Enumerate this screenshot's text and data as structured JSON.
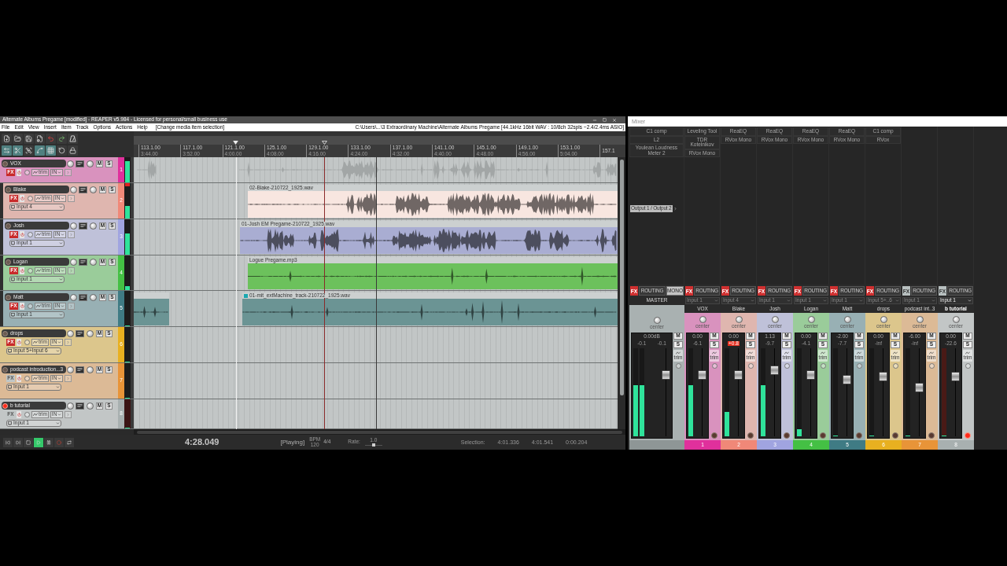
{
  "reaper": {
    "title": "Alternate Albums Pregame [modified] - REAPER v5.984 - Licensed for personal/small business use",
    "menu": [
      "File",
      "Edit",
      "View",
      "Insert",
      "Item",
      "Track",
      "Options",
      "Actions",
      "Help"
    ],
    "last_action": "[Change media item selection]",
    "project_info": "C:\\Users\\...\\3 Extraordinary Machine\\Alternate Albums Pregame [44.1kHz 16bit WAV : 10/8ch 32spls ~2.4/2.4ms ASIO]",
    "toolbar": [
      {
        "kind": "new",
        "on": false
      },
      {
        "kind": "open",
        "on": false
      },
      {
        "kind": "save",
        "on": false
      },
      {
        "kind": "settings",
        "on": false
      },
      {
        "kind": "undo",
        "on": false
      },
      {
        "kind": "redo",
        "on": false
      },
      {
        "kind": "metronome",
        "on": false
      },
      {
        "kind": "crossfade",
        "on": true
      },
      {
        "kind": "split",
        "on": true
      },
      {
        "kind": "group",
        "on": false
      },
      {
        "kind": "envelope",
        "on": true
      },
      {
        "kind": "grid",
        "on": true
      },
      {
        "kind": "ripple",
        "on": false
      },
      {
        "kind": "lock",
        "on": false
      }
    ],
    "ruler": [
      {
        "bar": "113.1.00",
        "time": "3:44.00"
      },
      {
        "bar": "117.1.00",
        "time": "3:52.00"
      },
      {
        "bar": "121.1.00",
        "time": "4:00.00"
      },
      {
        "bar": "125.1.00",
        "time": "4:08.00"
      },
      {
        "bar": "129.1.00",
        "time": "4:16.00"
      },
      {
        "bar": "133.1.00",
        "time": "4:24.00"
      },
      {
        "bar": "137.1.00",
        "time": "4:32.00"
      },
      {
        "bar": "141.1.00",
        "time": "4:40.00"
      },
      {
        "bar": "145.1.00",
        "time": "4:48.00"
      },
      {
        "bar": "149.1.00",
        "time": "4:56.00"
      },
      {
        "bar": "153.1.00",
        "time": "5:04.00"
      },
      {
        "bar": "157.1"
      }
    ],
    "tracks": [
      {
        "number": "1",
        "name": "VOX",
        "color": "#e0309c",
        "armed": false,
        "fx_active": true,
        "level": 0.85,
        "clip": false,
        "controls": {
          "fx": "FX",
          "trim": "trim",
          "monitor": "IN",
          "mute": "M",
          "solo": "S"
        },
        "items": [
          {
            "kind": "summary"
          },
          {
            "kind": "summary"
          }
        ],
        "children": [
          {
            "number": "2",
            "name": "Blake",
            "color": "#f08878",
            "armed": false,
            "fx_active": true,
            "level": 0.35,
            "clip": true,
            "input": "Input 4",
            "controls": {
              "fx": "FX",
              "trim": "trim",
              "monitor": "IN",
              "mute": "M",
              "solo": "S"
            },
            "items": [
              {
                "kind": "audio",
                "label": "02-Blake-210722_1925.wav",
                "color": "#f8e6e0",
                "indicator": false
              }
            ]
          },
          {
            "number": "3",
            "name": "Josh",
            "color": "#a0a4e0",
            "armed": false,
            "fx_active": true,
            "level": 0.6,
            "clip": false,
            "input": "Input 1",
            "controls": {
              "fx": "FX",
              "trim": "trim",
              "monitor": "IN",
              "mute": "M",
              "solo": "S"
            },
            "items": [
              {
                "kind": "audio",
                "label": "01-Josh EM Pregame-210722_1925.wav",
                "color": "#a9add2",
                "indicator": false
              }
            ]
          },
          {
            "number": "4",
            "name": "Logan",
            "color": "#44c044",
            "armed": false,
            "fx_active": true,
            "level": 0.12,
            "clip": false,
            "input": "Input 1",
            "controls": {
              "fx": "FX",
              "trim": "trim",
              "monitor": "IN",
              "mute": "M",
              "solo": "S"
            },
            "items": [
              {
                "kind": "audio",
                "label": "Logue Pregame.mp3",
                "color": "#6cc15c",
                "indicator": false
              }
            ]
          },
          {
            "number": "5",
            "name": "Matt",
            "color": "#3f7b84",
            "armed": false,
            "fx_active": true,
            "level": 0,
            "clip": false,
            "input": "Input 1",
            "controls": {
              "fx": "FX",
              "trim": "trim",
              "monitor": "IN",
              "mute": "M",
              "solo": "S"
            },
            "items": [
              {
                "kind": "audio",
                "color": "#6b9494",
                "indicator": false
              },
              {
                "kind": "audio",
                "label": "01-mit_extMachine_track-210722_1925.wav",
                "color": "#6b9494",
                "indicator": true
              }
            ]
          }
        ]
      },
      {
        "number": "6",
        "name": "drops",
        "color": "#e8b020",
        "armed": false,
        "fx_active": true,
        "level": 0,
        "clip": false,
        "input": "Input 5+Input 6",
        "controls": {
          "fx": "FX",
          "trim": "trim",
          "monitor": "IN",
          "mute": "M",
          "solo": "S"
        }
      },
      {
        "number": "7",
        "name": "podcast introduction...3",
        "color": "#e89438",
        "armed": false,
        "fx_active": false,
        "level": 0,
        "clip": false,
        "input": "Input 1",
        "controls": {
          "fx": "FX",
          "trim": "trim",
          "monitor": "IN",
          "mute": "M",
          "solo": "S"
        }
      },
      {
        "number": "8",
        "name": "b tutorial",
        "color": "#a8b0b0",
        "armed": true,
        "fx_active": false,
        "level": 0,
        "clip": false,
        "input": "Input 1",
        "controls": {
          "fx": "FX",
          "trim": "trim",
          "monitor": "IN",
          "mute": "M",
          "solo": "S"
        }
      }
    ],
    "transport": {
      "buttons": [
        {
          "kind": "skip_back",
          "on": false
        },
        {
          "kind": "skip_forward",
          "on": false
        },
        {
          "kind": "stop",
          "on": false
        },
        {
          "kind": "play",
          "on": true
        },
        {
          "kind": "pause",
          "on": false
        },
        {
          "kind": "record",
          "on": false
        },
        {
          "kind": "repeat",
          "on": false
        }
      ],
      "time": "4:28.049",
      "status": "[Playing]",
      "bpm_label": "BPM",
      "bpm": "120",
      "time_signature": "4/4",
      "rate_label": "Rate:",
      "rate": "1.0",
      "rate_slider": {
        "level": 0.5
      },
      "selection_label": "Selection:",
      "selection": [
        "4:01.336",
        "4:01.541",
        "0:00.204"
      ]
    }
  },
  "mixer": {
    "title": "Mixer",
    "strips": [
      {
        "kind": "master",
        "name": "MASTER",
        "fx": [
          "C1 comp",
          "L2",
          "Youlean Loudness Meter 2"
        ],
        "output": "Output 1 / Output 2",
        "controls": {
          "fx": "FX",
          "routing": "ROUTING",
          "mono": "MONO",
          "mute": "M",
          "solo": "S",
          "trim": "trim"
        },
        "pan": "center",
        "volume": "0.00dB",
        "peaks": [
          "-0.1",
          "-0.1"
        ],
        "meters": [
          {
            "level": 0.58
          },
          {
            "level": 0.58
          }
        ],
        "fader": {
          "level": 0.72
        },
        "fx_active": true,
        "clip": false,
        "selected": false
      },
      {
        "kind": "track",
        "number": "1",
        "name": "VOX",
        "color": "#e0309c",
        "input": "Input 1",
        "fx": [
          "Leveling Tool",
          "TDR Kotelnikov",
          "RVox Mono"
        ],
        "controls": {
          "fx": "FX",
          "routing": "ROUTING",
          "mute": "M",
          "solo": "S",
          "trim": "trim"
        },
        "pan": "center",
        "volume": "0.00",
        "peaks": [
          "-6.1"
        ],
        "meters": [
          {
            "level": 0.58
          }
        ],
        "fader": {
          "level": 0.72
        },
        "fx_active": true,
        "armed": false,
        "clip": false,
        "selected": false
      },
      {
        "kind": "track",
        "number": "2",
        "name": "Blake",
        "color": "#f08878",
        "input": "Input 4",
        "fx": [
          "ReaEQ",
          "RVox Mono"
        ],
        "controls": {
          "fx": "FX",
          "routing": "ROUTING",
          "mute": "M",
          "solo": "S",
          "trim": "trim"
        },
        "pan": "center",
        "volume": "0.00",
        "peaks": [
          "+0.8"
        ],
        "meters": [
          {
            "level": 0.28
          }
        ],
        "fader": {
          "level": 0.72
        },
        "fx_active": true,
        "armed": false,
        "clip": true,
        "selected": false
      },
      {
        "kind": "track",
        "number": "3",
        "name": "Josh",
        "color": "#a0a4e0",
        "input": "Input 1",
        "fx": [
          "ReaEQ",
          "RVox Mono"
        ],
        "controls": {
          "fx": "FX",
          "routing": "ROUTING",
          "mute": "M",
          "solo": "S",
          "trim": "trim"
        },
        "pan": "center",
        "volume": "1.13",
        "peaks": [
          "-9.7"
        ],
        "meters": [
          {
            "level": 0.58
          }
        ],
        "fader": {
          "level": 0.78
        },
        "fx_active": true,
        "armed": false,
        "clip": false,
        "selected": false
      },
      {
        "kind": "track",
        "number": "4",
        "name": "Logan",
        "color": "#44c044",
        "input": "Input 1",
        "fx": [
          "ReaEQ",
          "RVox Mono"
        ],
        "controls": {
          "fx": "FX",
          "routing": "ROUTING",
          "mute": "M",
          "solo": "S",
          "trim": "trim"
        },
        "pan": "center",
        "volume": "0.00",
        "peaks": [
          "-4.1"
        ],
        "meters": [
          {
            "level": 0.08
          }
        ],
        "fader": {
          "level": 0.72
        },
        "fx_active": true,
        "armed": false,
        "clip": false,
        "selected": false
      },
      {
        "kind": "track",
        "number": "5",
        "name": "Matt",
        "color": "#3f7b84",
        "input": "Input 1",
        "fx": [
          "ReaEQ",
          "RVox Mono"
        ],
        "controls": {
          "fx": "FX",
          "routing": "ROUTING",
          "mute": "M",
          "solo": "S",
          "trim": "trim"
        },
        "pan": "center",
        "volume": "-2.00",
        "peaks": [
          "-7.7"
        ],
        "meters": [
          {
            "level": 0
          }
        ],
        "fader": {
          "level": 0.66
        },
        "fx_active": true,
        "armed": false,
        "clip": false,
        "selected": false
      },
      {
        "kind": "track",
        "number": "6",
        "name": "drops",
        "color": "#e8b020",
        "input": "Input 5+..6",
        "fx": [
          "C1 comp",
          "RVox"
        ],
        "controls": {
          "fx": "FX",
          "routing": "ROUTING",
          "mute": "M",
          "solo": "S",
          "trim": "trim"
        },
        "pan": "center",
        "volume": "0.00",
        "peaks": [
          "-inf"
        ],
        "meters": [
          {
            "level": 0
          }
        ],
        "fader": {
          "level": 0.7
        },
        "fx_active": true,
        "armed": false,
        "clip": false,
        "selected": false
      },
      {
        "kind": "track",
        "number": "7",
        "name": "podcast int..3",
        "color": "#e89438",
        "input": "Input 1",
        "controls": {
          "fx": "FX",
          "routing": "ROUTING",
          "mute": "M",
          "solo": "S",
          "trim": "trim"
        },
        "pan": "center",
        "volume": "-6.00",
        "peaks": [
          "-inf"
        ],
        "meters": [
          {
            "level": 0
          }
        ],
        "fader": {
          "level": 0.56
        },
        "fx_active": false,
        "armed": false,
        "clip": false,
        "selected": false
      },
      {
        "kind": "track",
        "number": "8",
        "name": "b tutorial",
        "color": "#a8b0b0",
        "input": "Input 1",
        "controls": {
          "fx": "FX",
          "routing": "ROUTING",
          "mute": "M",
          "solo": "S",
          "trim": "trim"
        },
        "pan": "center",
        "volume": "0.00",
        "peaks": [
          "-22.6"
        ],
        "meters": [
          {
            "level": 0
          }
        ],
        "fader": {
          "level": 0.7
        },
        "fx_active": false,
        "armed": true,
        "clip": false,
        "selected": true
      }
    ]
  }
}
